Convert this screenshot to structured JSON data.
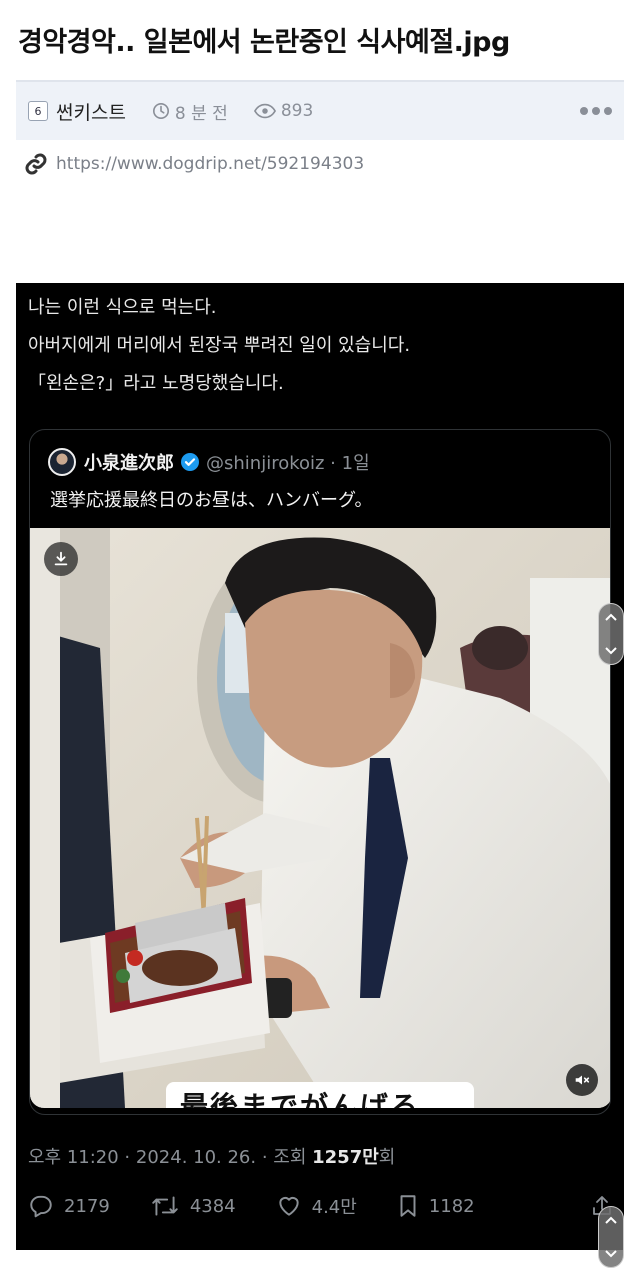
{
  "post": {
    "title": "경악경악.. 일본에서 논란중인 식사예절.jpg",
    "level": "6",
    "author": "썬키스트",
    "time_ago": "8 분 전",
    "views": "893",
    "url": "https://www.dogdrip.net/592194303"
  },
  "caption": {
    "lines": [
      "나는 이런 식으로 먹는다.",
      "아버지에게 머리에서 된장국 뿌려진 일이 있습니다.",
      "「왼손은?」라고 노명당했습니다."
    ]
  },
  "quote": {
    "name": "小泉進次郎",
    "handle_time": "@shinjirokoiz · 1일",
    "text": "選挙応援最終日のお昼は、ハンバーグ。",
    "video_subtitle": "最後までがんばろ"
  },
  "tweet": {
    "time_prefix": "오후 11:20 · 2024. 10. 26. · 조회 ",
    "views": "1257만",
    "views_suffix": "회",
    "replies": "2179",
    "retweets": "4384",
    "likes": "4.4만",
    "bookmarks": "1182"
  },
  "icons": [
    "level-badge-icon",
    "clock-icon",
    "eye-icon",
    "more-icon",
    "link-icon",
    "verified-icon",
    "download-icon",
    "mute-icon",
    "reply-icon",
    "retweet-icon",
    "like-icon",
    "bookmark-icon",
    "share-icon",
    "chevron-up-icon",
    "chevron-down-icon"
  ],
  "colors": {
    "meta_bg": "#eef2f8",
    "verified": "#1d9bf0",
    "dark_bg": "#000000"
  }
}
